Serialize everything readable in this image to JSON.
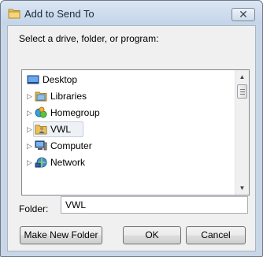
{
  "window": {
    "title": "Add to Send To",
    "close_glyph": "✕"
  },
  "prompt": "Select a drive, folder, or program:",
  "tree": {
    "items": [
      {
        "label": "Desktop",
        "icon": "desktop-icon",
        "has_children": false,
        "selected": false
      },
      {
        "label": "Libraries",
        "icon": "libraries-icon",
        "has_children": true,
        "selected": false
      },
      {
        "label": "Homegroup",
        "icon": "homegroup-icon",
        "has_children": true,
        "selected": false
      },
      {
        "label": "VWL",
        "icon": "user-folder-icon",
        "has_children": true,
        "selected": true
      },
      {
        "label": "Computer",
        "icon": "computer-icon",
        "has_children": true,
        "selected": false
      },
      {
        "label": "Network",
        "icon": "network-icon",
        "has_children": true,
        "selected": false
      }
    ],
    "expander_glyph": "▷",
    "scroll_up_glyph": "▲",
    "scroll_down_glyph": "▼"
  },
  "folder": {
    "label": "Folder:",
    "value": "VWL"
  },
  "buttons": {
    "new_folder": "Make New Folder",
    "ok": "OK",
    "cancel": "Cancel"
  },
  "colors": {
    "selection": "#eef2f7",
    "frame": "#c8d6e8",
    "client": "#f0f0f0"
  }
}
